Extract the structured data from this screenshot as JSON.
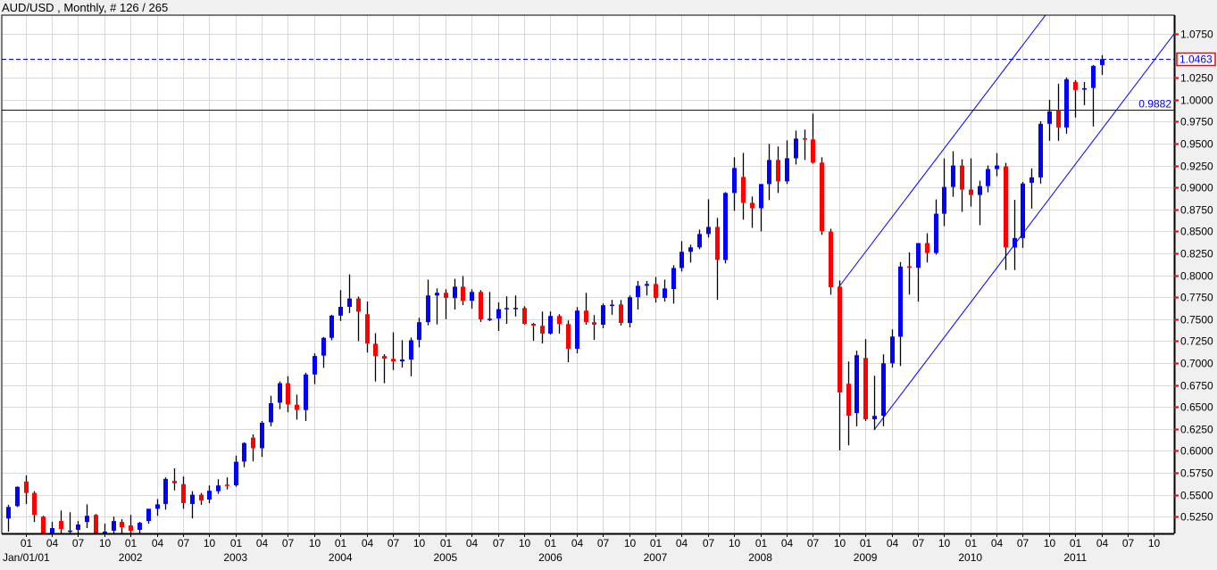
{
  "header": {
    "title": "AUD/USD , Monthly, # 126 / 265"
  },
  "colors": {
    "bull": "#0000ff",
    "bear": "#ff0000",
    "wick": "#000000",
    "grid": "#d9d9d9",
    "line": "#0000ff",
    "price_box": "#ff0000"
  },
  "chart_data": {
    "type": "candlestick",
    "title": "AUD/USD , Monthly, # 126 / 265",
    "ylim": [
      0.5059,
      1.0963
    ],
    "xlim_index": [
      -0.71,
      133.3
    ],
    "grid": true,
    "y_ticks": [
      "0.5250",
      "0.5500",
      "0.5750",
      "0.6000",
      "0.6250",
      "0.6500",
      "0.6750",
      "0.7000",
      "0.7250",
      "0.7500",
      "0.7750",
      "0.8000",
      "0.8250",
      "0.8500",
      "0.8750",
      "0.9000",
      "0.9250",
      "0.9500",
      "0.9750",
      "1.0000",
      "1.0250",
      "1.0750"
    ],
    "x_ticks": {
      "first_index": 2,
      "step": 3,
      "labels": [
        "01",
        "04",
        "07",
        "10"
      ],
      "count": 44
    },
    "x_year_labels": [
      {
        "index": 2,
        "label": "Jan/01/01",
        "align": "left"
      },
      {
        "index": 14,
        "label": "2002"
      },
      {
        "index": 26,
        "label": "2003"
      },
      {
        "index": 38,
        "label": "2004"
      },
      {
        "index": 50,
        "label": "2005"
      },
      {
        "index": 62,
        "label": "2006"
      },
      {
        "index": 74,
        "label": "2007"
      },
      {
        "index": 86,
        "label": "2008"
      },
      {
        "index": 98,
        "label": "2009"
      },
      {
        "index": 110,
        "label": "2010"
      },
      {
        "index": 122,
        "label": "2011"
      }
    ],
    "current_price": {
      "value": 1.0463,
      "label": "1.0463"
    },
    "horizontal_line": {
      "value": 0.9882,
      "label": "0.9882"
    },
    "trend_lines": [
      {
        "name": "channel-lower",
        "from": [
          99,
          0.6238
        ],
        "to": [
          133.3,
          1.075
        ]
      },
      {
        "name": "channel-upper",
        "from": [
          95,
          0.787
        ],
        "to": [
          118.6,
          1.0963
        ]
      }
    ],
    "ohlc_format": [
      "open",
      "high",
      "low",
      "close"
    ],
    "ohlc": [
      [
        0.523,
        0.5385,
        0.508,
        0.536
      ],
      [
        0.537,
        0.5595,
        0.536,
        0.559
      ],
      [
        0.565,
        0.572,
        0.5395,
        0.552
      ],
      [
        0.552,
        0.554,
        0.519,
        0.527
      ],
      [
        0.525,
        0.526,
        0.485,
        0.495
      ],
      [
        0.495,
        0.519,
        0.49,
        0.512
      ],
      [
        0.52,
        0.532,
        0.5,
        0.511
      ],
      [
        0.509,
        0.53,
        0.5,
        0.5092
      ],
      [
        0.51,
        0.52,
        0.505,
        0.516
      ],
      [
        0.519,
        0.539,
        0.512,
        0.526
      ],
      [
        0.527,
        0.528,
        0.48,
        0.49
      ],
      [
        0.49,
        0.517,
        0.485,
        0.508
      ],
      [
        0.509,
        0.525,
        0.504,
        0.52
      ],
      [
        0.519,
        0.522,
        0.503,
        0.513
      ],
      [
        0.515,
        0.527,
        0.503,
        0.509
      ],
      [
        0.51,
        0.519,
        0.504,
        0.518
      ],
      [
        0.52,
        0.534,
        0.517,
        0.534
      ],
      [
        0.534,
        0.545,
        0.526,
        0.539
      ],
      [
        0.5395,
        0.5697,
        0.533,
        0.568
      ],
      [
        0.5657,
        0.58,
        0.555,
        0.563
      ],
      [
        0.562,
        0.5707,
        0.534,
        0.5405
      ],
      [
        0.5395,
        0.554,
        0.523,
        0.55
      ],
      [
        0.55,
        0.552,
        0.5385,
        0.5435
      ],
      [
        0.5445,
        0.5605,
        0.5405,
        0.5545
      ],
      [
        0.554,
        0.5677,
        0.551,
        0.5605
      ],
      [
        0.5615,
        0.5697,
        0.556,
        0.561
      ],
      [
        0.5607,
        0.5945,
        0.559,
        0.5875
      ],
      [
        0.5878,
        0.6098,
        0.5814,
        0.6088
      ],
      [
        0.615,
        0.6187,
        0.588,
        0.603
      ],
      [
        0.603,
        0.634,
        0.593,
        0.632
      ],
      [
        0.6325,
        0.6627,
        0.628,
        0.6543
      ],
      [
        0.6549,
        0.679,
        0.6475,
        0.677
      ],
      [
        0.677,
        0.685,
        0.644,
        0.653
      ],
      [
        0.6525,
        0.664,
        0.6355,
        0.6467
      ],
      [
        0.6465,
        0.689,
        0.634,
        0.687
      ],
      [
        0.687,
        0.711,
        0.676,
        0.708
      ],
      [
        0.7085,
        0.7297,
        0.6945,
        0.7287
      ],
      [
        0.7287,
        0.755,
        0.726,
        0.754
      ],
      [
        0.754,
        0.783,
        0.748,
        0.764
      ],
      [
        0.764,
        0.801,
        0.757,
        0.7735
      ],
      [
        0.7735,
        0.7758,
        0.725,
        0.7585
      ],
      [
        0.7556,
        0.77,
        0.712,
        0.7224
      ],
      [
        0.722,
        0.734,
        0.679,
        0.708
      ],
      [
        0.708,
        0.71,
        0.677,
        0.705
      ],
      [
        0.7048,
        0.735,
        0.692,
        0.702
      ],
      [
        0.702,
        0.726,
        0.695,
        0.704
      ],
      [
        0.704,
        0.729,
        0.685,
        0.726
      ],
      [
        0.7265,
        0.7515,
        0.718,
        0.7465
      ],
      [
        0.7467,
        0.795,
        0.743,
        0.777
      ],
      [
        0.777,
        0.785,
        0.744,
        0.78
      ],
      [
        0.78,
        0.784,
        0.75,
        0.7742
      ],
      [
        0.774,
        0.796,
        0.761,
        0.787
      ],
      [
        0.787,
        0.799,
        0.766,
        0.771
      ],
      [
        0.771,
        0.784,
        0.762,
        0.781
      ],
      [
        0.781,
        0.783,
        0.7468,
        0.7498
      ],
      [
        0.75,
        0.781,
        0.7478,
        0.7505
      ],
      [
        0.7508,
        0.769,
        0.7366,
        0.7614
      ],
      [
        0.7625,
        0.776,
        0.7447,
        0.7627
      ],
      [
        0.7627,
        0.777,
        0.753,
        0.7629
      ],
      [
        0.7627,
        0.7647,
        0.7437,
        0.7447
      ],
      [
        0.7447,
        0.7457,
        0.7254,
        0.7427
      ],
      [
        0.7424,
        0.7587,
        0.7224,
        0.7336
      ],
      [
        0.7336,
        0.7587,
        0.7325,
        0.7536
      ],
      [
        0.7536,
        0.7556,
        0.7336,
        0.7447
      ],
      [
        0.7444,
        0.7485,
        0.701,
        0.7163
      ],
      [
        0.7163,
        0.7637,
        0.7112,
        0.7597
      ],
      [
        0.7597,
        0.78,
        0.7437,
        0.7468
      ],
      [
        0.7465,
        0.7546,
        0.7264,
        0.7437
      ],
      [
        0.7437,
        0.7678,
        0.7396,
        0.7658
      ],
      [
        0.7662,
        0.772,
        0.755,
        0.7665
      ],
      [
        0.7668,
        0.7718,
        0.7427,
        0.7457
      ],
      [
        0.7457,
        0.777,
        0.7407,
        0.775
      ],
      [
        0.7752,
        0.7935,
        0.761,
        0.788
      ],
      [
        0.788,
        0.7935,
        0.777,
        0.79
      ],
      [
        0.79,
        0.798,
        0.769,
        0.7742
      ],
      [
        0.7742,
        0.795,
        0.77,
        0.785
      ],
      [
        0.7843,
        0.8114,
        0.7677,
        0.8083
      ],
      [
        0.8083,
        0.8389,
        0.8043,
        0.8267
      ],
      [
        0.8267,
        0.8348,
        0.8145,
        0.8318
      ],
      [
        0.8318,
        0.852,
        0.8297,
        0.847
      ],
      [
        0.847,
        0.8866,
        0.843,
        0.855
      ],
      [
        0.855,
        0.8653,
        0.772,
        0.8175
      ],
      [
        0.8175,
        0.8947,
        0.8135,
        0.8937
      ],
      [
        0.8937,
        0.9344,
        0.8734,
        0.9222
      ],
      [
        0.912,
        0.9394,
        0.8633,
        0.8825
      ],
      [
        0.8825,
        0.8897,
        0.854,
        0.8764
      ],
      [
        0.8764,
        0.9039,
        0.85,
        0.9039
      ],
      [
        0.9039,
        0.9496,
        0.8856,
        0.9313
      ],
      [
        0.9313,
        0.9466,
        0.8937,
        0.907
      ],
      [
        0.907,
        0.9537,
        0.904,
        0.9333
      ],
      [
        0.9333,
        0.9648,
        0.9262,
        0.9557
      ],
      [
        0.956,
        0.9659,
        0.9313,
        0.9557
      ],
      [
        0.9547,
        0.9841,
        0.9272,
        0.9283
      ],
      [
        0.9283,
        0.9344,
        0.846,
        0.8503
      ],
      [
        0.8497,
        0.853,
        0.7779,
        0.7864
      ],
      [
        0.787,
        0.794,
        0.6005,
        0.6665
      ],
      [
        0.6764,
        0.7018,
        0.6063,
        0.64
      ],
      [
        0.643,
        0.714,
        0.628,
        0.7089
      ],
      [
        0.7058,
        0.7272,
        0.634,
        0.636
      ],
      [
        0.636,
        0.6855,
        0.6238,
        0.6398
      ],
      [
        0.64,
        0.7099,
        0.628,
        0.6997
      ],
      [
        0.6997,
        0.7383,
        0.695,
        0.7302
      ],
      [
        0.73,
        0.815,
        0.6966,
        0.8099
      ],
      [
        0.8102,
        0.826,
        0.778,
        0.8085
      ],
      [
        0.8085,
        0.8366,
        0.77,
        0.8366
      ],
      [
        0.8366,
        0.8478,
        0.8146,
        0.8254
      ],
      [
        0.8254,
        0.8864,
        0.8234,
        0.8701
      ],
      [
        0.8701,
        0.9331,
        0.856,
        0.9006
      ],
      [
        0.9006,
        0.9413,
        0.8894,
        0.925
      ],
      [
        0.925,
        0.932,
        0.8722,
        0.8976
      ],
      [
        0.8976,
        0.9331,
        0.8783,
        0.8915
      ],
      [
        0.8915,
        0.9077,
        0.857,
        0.9016
      ],
      [
        0.9016,
        0.925,
        0.8945,
        0.921
      ],
      [
        0.921,
        0.9392,
        0.9128,
        0.925
      ],
      [
        0.924,
        0.928,
        0.806,
        0.8318
      ],
      [
        0.8316,
        0.886,
        0.806,
        0.8424
      ],
      [
        0.8424,
        0.9064,
        0.8313,
        0.9045
      ],
      [
        0.9054,
        0.9217,
        0.876,
        0.9115
      ],
      [
        0.9115,
        0.9755,
        0.9045,
        0.9725
      ],
      [
        0.9725,
        0.9999,
        0.9532,
        0.9867
      ],
      [
        0.9884,
        1.0182,
        0.9532,
        0.9684
      ],
      [
        0.9684,
        1.0253,
        0.9613,
        1.0233
      ],
      [
        1.0202,
        1.0223,
        0.9796,
        1.0111
      ],
      [
        1.0114,
        1.0202,
        0.9938,
        1.0131
      ],
      [
        1.0134,
        1.0395,
        0.9695,
        1.0385
      ],
      [
        1.0395,
        1.0507,
        1.0283,
        1.0463
      ]
    ]
  }
}
